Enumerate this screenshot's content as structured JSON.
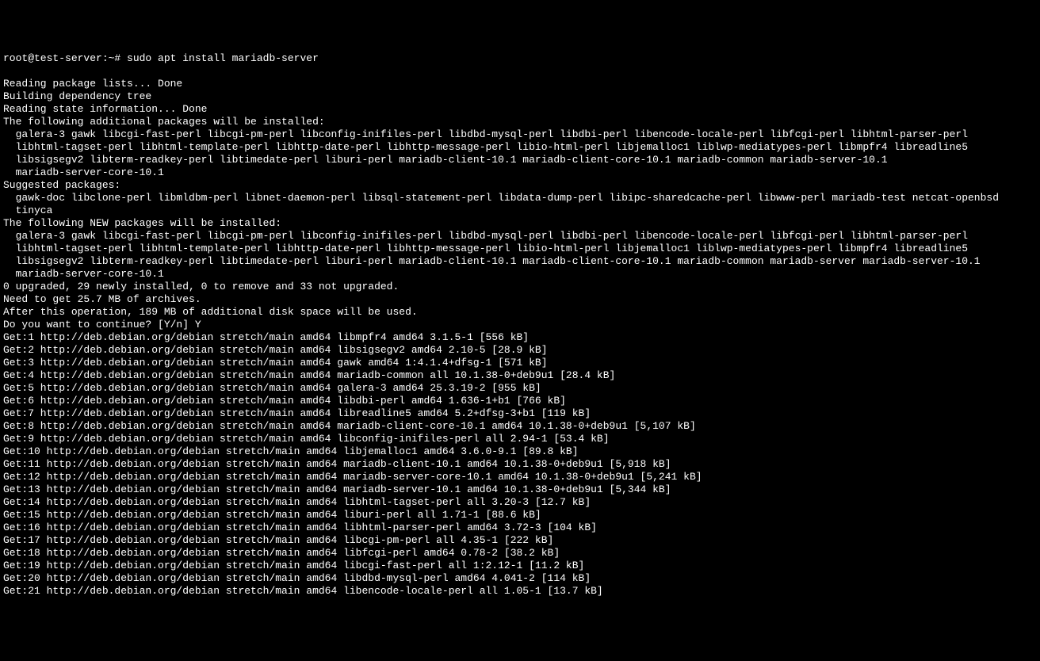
{
  "prompt": "root@test-server:~# sudo apt install mariadb-server",
  "lines": [
    "Reading package lists... Done",
    "Building dependency tree",
    "Reading state information... Done",
    "The following additional packages will be installed:"
  ],
  "additional_packages": [
    "  galera-3 gawk libcgi-fast-perl libcgi-pm-perl libconfig-inifiles-perl libdbd-mysql-perl libdbi-perl libencode-locale-perl libfcgi-perl libhtml-parser-perl",
    "  libhtml-tagset-perl libhtml-template-perl libhttp-date-perl libhttp-message-perl libio-html-perl libjemalloc1 liblwp-mediatypes-perl libmpfr4 libreadline5",
    "  libsigsegv2 libterm-readkey-perl libtimedate-perl liburi-perl mariadb-client-10.1 mariadb-client-core-10.1 mariadb-common mariadb-server-10.1",
    "  mariadb-server-core-10.1"
  ],
  "suggested_header": "Suggested packages:",
  "suggested_packages": [
    "  gawk-doc libclone-perl libmldbm-perl libnet-daemon-perl libsql-statement-perl libdata-dump-perl libipc-sharedcache-perl libwww-perl mariadb-test netcat-openbsd",
    "  tinyca"
  ],
  "new_header": "The following NEW packages will be installed:",
  "new_packages": [
    "  galera-3 gawk libcgi-fast-perl libcgi-pm-perl libconfig-inifiles-perl libdbd-mysql-perl libdbi-perl libencode-locale-perl libfcgi-perl libhtml-parser-perl",
    "  libhtml-tagset-perl libhtml-template-perl libhttp-date-perl libhttp-message-perl libio-html-perl libjemalloc1 liblwp-mediatypes-perl libmpfr4 libreadline5",
    "  libsigsegv2 libterm-readkey-perl libtimedate-perl liburi-perl mariadb-client-10.1 mariadb-client-core-10.1 mariadb-common mariadb-server mariadb-server-10.1",
    "  mariadb-server-core-10.1"
  ],
  "summary": [
    "0 upgraded, 29 newly installed, 0 to remove and 33 not upgraded.",
    "Need to get 25.7 MB of archives.",
    "After this operation, 189 MB of additional disk space will be used.",
    "Do you want to continue? [Y/n] Y"
  ],
  "downloads": [
    "Get:1 http://deb.debian.org/debian stretch/main amd64 libmpfr4 amd64 3.1.5-1 [556 kB]",
    "Get:2 http://deb.debian.org/debian stretch/main amd64 libsigsegv2 amd64 2.10-5 [28.9 kB]",
    "Get:3 http://deb.debian.org/debian stretch/main amd64 gawk amd64 1:4.1.4+dfsg-1 [571 kB]",
    "Get:4 http://deb.debian.org/debian stretch/main amd64 mariadb-common all 10.1.38-0+deb9u1 [28.4 kB]",
    "Get:5 http://deb.debian.org/debian stretch/main amd64 galera-3 amd64 25.3.19-2 [955 kB]",
    "Get:6 http://deb.debian.org/debian stretch/main amd64 libdbi-perl amd64 1.636-1+b1 [766 kB]",
    "Get:7 http://deb.debian.org/debian stretch/main amd64 libreadline5 amd64 5.2+dfsg-3+b1 [119 kB]",
    "Get:8 http://deb.debian.org/debian stretch/main amd64 mariadb-client-core-10.1 amd64 10.1.38-0+deb9u1 [5,107 kB]",
    "Get:9 http://deb.debian.org/debian stretch/main amd64 libconfig-inifiles-perl all 2.94-1 [53.4 kB]",
    "Get:10 http://deb.debian.org/debian stretch/main amd64 libjemalloc1 amd64 3.6.0-9.1 [89.8 kB]",
    "Get:11 http://deb.debian.org/debian stretch/main amd64 mariadb-client-10.1 amd64 10.1.38-0+deb9u1 [5,918 kB]",
    "Get:12 http://deb.debian.org/debian stretch/main amd64 mariadb-server-core-10.1 amd64 10.1.38-0+deb9u1 [5,241 kB]",
    "Get:13 http://deb.debian.org/debian stretch/main amd64 mariadb-server-10.1 amd64 10.1.38-0+deb9u1 [5,344 kB]",
    "Get:14 http://deb.debian.org/debian stretch/main amd64 libhtml-tagset-perl all 3.20-3 [12.7 kB]",
    "Get:15 http://deb.debian.org/debian stretch/main amd64 liburi-perl all 1.71-1 [88.6 kB]",
    "Get:16 http://deb.debian.org/debian stretch/main amd64 libhtml-parser-perl amd64 3.72-3 [104 kB]",
    "Get:17 http://deb.debian.org/debian stretch/main amd64 libcgi-pm-perl all 4.35-1 [222 kB]",
    "Get:18 http://deb.debian.org/debian stretch/main amd64 libfcgi-perl amd64 0.78-2 [38.2 kB]",
    "Get:19 http://deb.debian.org/debian stretch/main amd64 libcgi-fast-perl all 1:2.12-1 [11.2 kB]",
    "Get:20 http://deb.debian.org/debian stretch/main amd64 libdbd-mysql-perl amd64 4.041-2 [114 kB]",
    "Get:21 http://deb.debian.org/debian stretch/main amd64 libencode-locale-perl all 1.05-1 [13.7 kB]"
  ]
}
